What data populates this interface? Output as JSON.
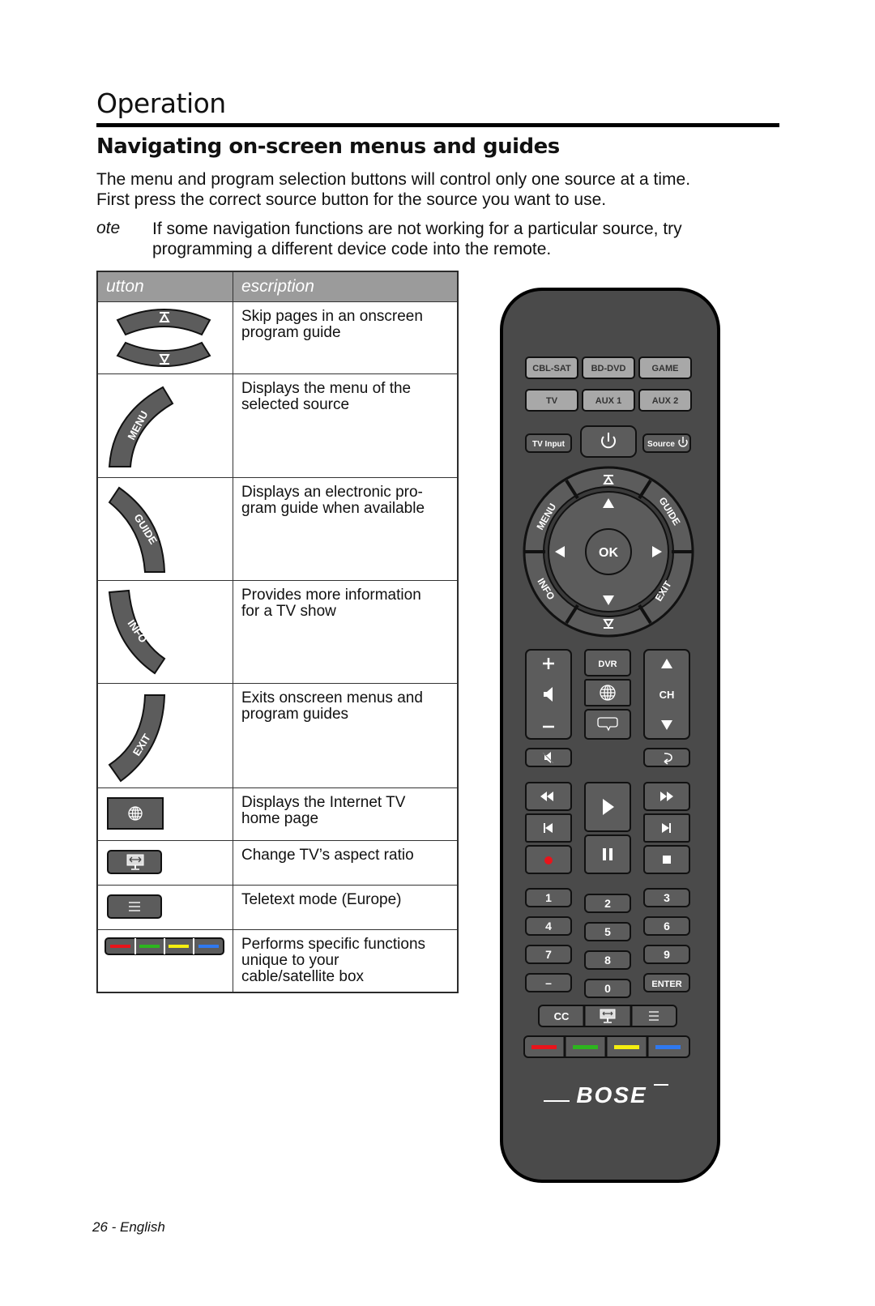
{
  "header": {
    "section_title": "Operation",
    "subtitle": "Navigating on-screen menus and guides"
  },
  "intro": {
    "line1": "The menu and program selection buttons will control only one source at a time.",
    "line2": "First press the correct source button for the source you want to use."
  },
  "note": {
    "label": "ote",
    "line1": "If some navigation functions are not working for a particular source, try",
    "line2": "programming a different device code into the remote."
  },
  "table": {
    "headers": [
      "utton",
      "escription"
    ],
    "rows": [
      {
        "icon": "page-up-down-icon",
        "lines": [
          "Skip pages in an onscreen",
          "program guide"
        ]
      },
      {
        "icon": "menu-arc-button",
        "icon_label": "MENU",
        "lines": [
          "Displays the menu of the",
          "selected source"
        ]
      },
      {
        "icon": "guide-arc-button",
        "icon_label": "GUIDE",
        "lines": [
          "Displays an electronic pro-",
          "gram guide when available"
        ]
      },
      {
        "icon": "info-arc-button",
        "icon_label": "INFO",
        "lines": [
          "Provides more information",
          "for a TV show"
        ]
      },
      {
        "icon": "exit-arc-button",
        "icon_label": "EXIT",
        "lines": [
          "Exits onscreen menus and",
          "program guides"
        ]
      },
      {
        "icon": "globe-icon",
        "lines": [
          "Displays the Internet TV",
          "home page"
        ]
      },
      {
        "icon": "aspect-ratio-icon",
        "lines": [
          "Change TV’s aspect ratio"
        ]
      },
      {
        "icon": "teletext-icon",
        "lines": [
          "Teletext mode (Europe)"
        ]
      },
      {
        "icon": "color-buttons",
        "lines": [
          "Performs specific functions",
          "unique to your",
          "cable/satellite box"
        ]
      }
    ]
  },
  "remote": {
    "source_buttons": [
      "CBL-SAT",
      "BD-DVD",
      "GAME",
      "TV",
      "AUX 1",
      "AUX 2"
    ],
    "tv_input": "TV Input",
    "source_power": "Source",
    "ring": {
      "menu": "MENU",
      "guide": "GUIDE",
      "info": "INFO",
      "exit": "EXIT",
      "ok": "OK"
    },
    "dvr": "DVR",
    "ch": "CH",
    "numbers": [
      "1",
      "2",
      "3",
      "4",
      "5",
      "6",
      "7",
      "8",
      "9",
      "–",
      "0",
      "ENTER"
    ],
    "cc": "CC",
    "brand": "BOSE",
    "colors": {
      "red": "#e8141b",
      "green": "#2db51e",
      "yellow": "#f4ee10",
      "blue": "#2f79f0"
    },
    "record_color": "#e8141b"
  },
  "footer": {
    "page": "26 - English"
  },
  "colors": {
    "table_header_bg": "#9b9b9b",
    "remote_body": "#4a4a4a",
    "remote_key": "#5c5c5c",
    "source_key": "#a8a8a8"
  }
}
